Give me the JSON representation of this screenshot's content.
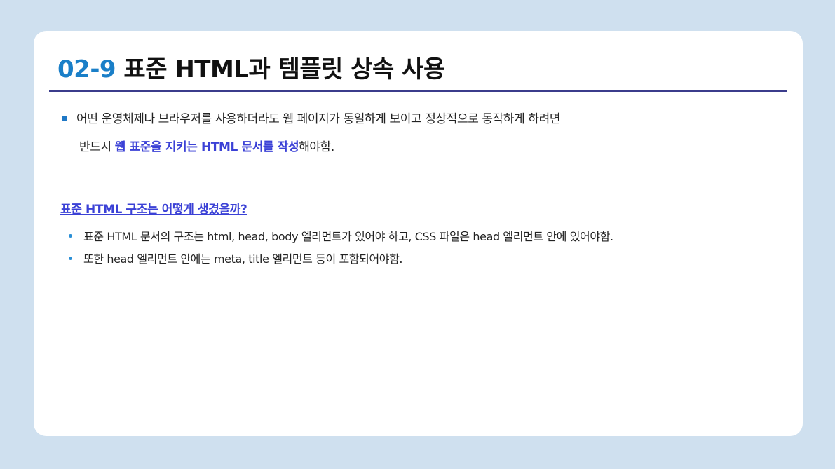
{
  "title": {
    "number": "02-9",
    "text": " 표준 HTML과 템플릿 상속 사용"
  },
  "intro": {
    "line1": "어떤 운영체제나 브라우저를 사용하더라도 웹 페이지가 동일하게 보이고 정상적으로 동작하게 하려면",
    "line2_prefix": "반드시 ",
    "line2_highlight": "웹 표준을 지키는 HTML 문서를 작성",
    "line2_suffix": "해야함."
  },
  "subheading": "표준 HTML 구조는 어떻게 생겼을까?",
  "points": [
    "표준 HTML 문서의 구조는 html, head, body 엘리먼트가 있어야 하고, CSS 파일은 head 엘리먼트 안에 있어야함.",
    "또한 head 엘리먼트 안에는 meta, title 엘리먼트 등이 포함되어야함."
  ],
  "colors": {
    "background": "#cfe0ef",
    "accent_number": "#1a7fc8",
    "highlight": "#3b41d6",
    "rule": "#3b3c8c"
  }
}
